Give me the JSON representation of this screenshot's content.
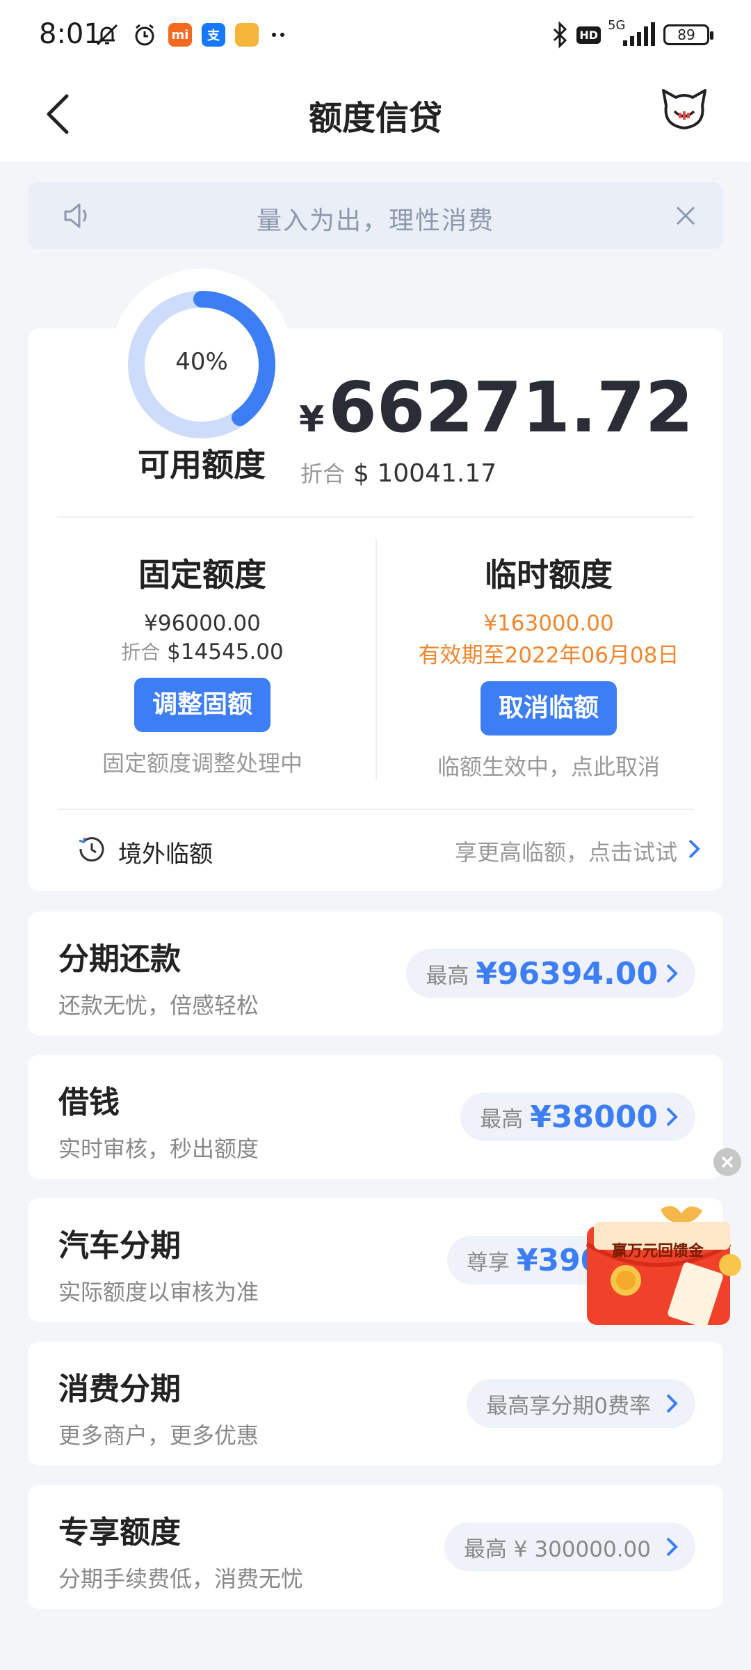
{
  "status_bar": {
    "time": "8:01",
    "battery": "89",
    "network": "5G",
    "hd_badge": "HD"
  },
  "header": {
    "title": "额度信贷"
  },
  "notice": {
    "text": "量入为出，理性消费"
  },
  "credit": {
    "percent": "40%",
    "percent_value": 40,
    "available_label": "可用额度",
    "currency_symbol": "¥",
    "amount": "66271.72",
    "converted_label": "折合",
    "converted_value": "$ 10041.17"
  },
  "fixed_limit": {
    "title": "固定额度",
    "amount": "¥96000.00",
    "converted_label": "折合",
    "converted_value": "$14545.00",
    "button": "调整固额",
    "note": "固定额度调整处理中"
  },
  "temp_limit": {
    "title": "临时额度",
    "amount": "¥163000.00",
    "validity": "有效期至2022年06月08日",
    "button": "取消临额",
    "note": "临额生效中，点此取消"
  },
  "overseas": {
    "label": "境外临额",
    "hint": "享更高临额，点击试试"
  },
  "products": [
    {
      "title": "分期还款",
      "subtitle": "还款无忧，倍感轻松",
      "pill_label": "最高",
      "pill_value": "¥96394.00"
    },
    {
      "title": "借钱",
      "subtitle": "实时审核，秒出额度",
      "pill_label": "最高",
      "pill_value": "¥38000"
    },
    {
      "title": "汽车分期",
      "subtitle": "实际额度以审核为准",
      "pill_label": "尊享",
      "pill_value": "¥3900"
    },
    {
      "title": "消费分期",
      "subtitle": "更多商户，更多优惠",
      "pill_label": "最高享分期0费率",
      "pill_value": ""
    },
    {
      "title": "专享额度",
      "subtitle": "分期手续费低，消费无忧",
      "pill_label": "最高 ¥ 300000.00",
      "pill_value": ""
    }
  ],
  "promo": {
    "text": "赢万元回馈金"
  },
  "colors": {
    "accent": "#3d7ef4",
    "orange": "#f0862d",
    "ring_bg": "#cddcfb"
  }
}
